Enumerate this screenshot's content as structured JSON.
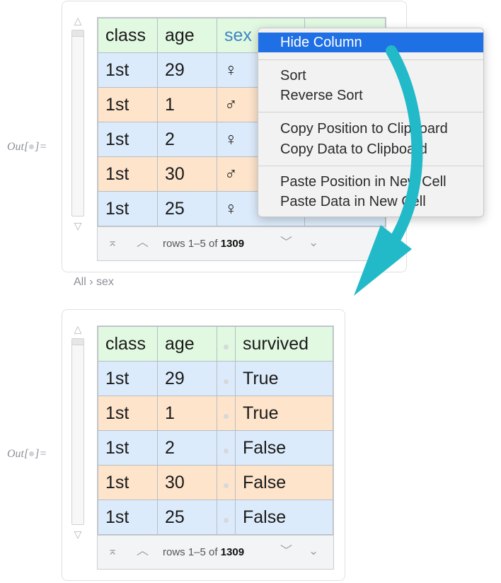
{
  "out_label": {
    "prefix": "Out[",
    "suffix": "]="
  },
  "columns_full": [
    "class",
    "age",
    "sex",
    "survived"
  ],
  "columns_hidden": [
    "class",
    "age",
    "",
    "survived"
  ],
  "rows": [
    {
      "class": "1st",
      "age": "29",
      "sex": "♀",
      "survived": "True"
    },
    {
      "class": "1st",
      "age": "1",
      "sex": "♂",
      "survived": "True"
    },
    {
      "class": "1st",
      "age": "2",
      "sex": "♀",
      "survived": "False"
    },
    {
      "class": "1st",
      "age": "30",
      "sex": "♂",
      "survived": "False"
    },
    {
      "class": "1st",
      "age": "25",
      "sex": "♀",
      "survived": "False"
    }
  ],
  "top_last_col_partial": "False",
  "footer": {
    "rows_text": "rows 1–5 of ",
    "total": "1309"
  },
  "breadcrumb": "All › sex",
  "context_menu": {
    "items": [
      "Hide Column",
      "Sort",
      "Reverse Sort",
      "Copy Position to Clipboard",
      "Copy Data to Clipboard",
      "Paste Position in New Cell",
      "Paste Data in New Cell"
    ],
    "selected": "Hide Column"
  },
  "colors": {
    "header_bg": "#e1f8e1",
    "row_blue": "#dcebfb",
    "row_orange": "#fde4cb",
    "menu_highlight": "#1f6fe5",
    "arrow": "#22b9c9",
    "sex_header_text": "#3f87c2"
  },
  "icons": [
    "scroll-up-triangle",
    "scroll-down-triangle",
    "first-page-icon",
    "prev-page-icon",
    "next-page-icon",
    "last-page-icon"
  ]
}
